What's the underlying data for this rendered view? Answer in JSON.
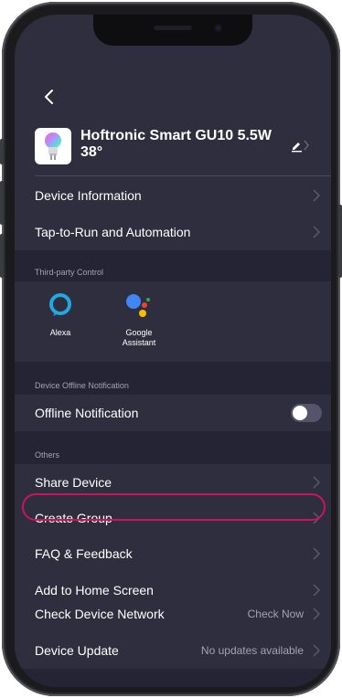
{
  "header": {
    "device_name": "Hoftronic Smart GU10 5.5W 38°",
    "thumb_icon": "bulb-icon",
    "edit_icon": "pencil-icon"
  },
  "rows": {
    "device_information": "Device Information",
    "tap_to_run": "Tap-to-Run and Automation",
    "offline_notification": "Offline Notification",
    "share_device": "Share Device",
    "create_group": "Create Group",
    "faq_feedback": "FAQ & Feedback",
    "add_home_screen": "Add to Home Screen",
    "check_network": "Check Device Network",
    "check_network_value": "Check Now",
    "device_update": "Device Update",
    "device_update_value": "No updates available"
  },
  "sections": {
    "third_party": "Third-party Control",
    "offline": "Device Offline Notification",
    "others": "Others"
  },
  "third_party": {
    "alexa": "Alexa",
    "google_line1": "Google",
    "google_line2": "Assistant"
  },
  "toggles": {
    "offline_notification_on": false
  },
  "colors": {
    "background": "#2f2e3f",
    "section_background": "#252434",
    "highlight": "#c8155b",
    "alexa": "#22a7e0",
    "google_blue": "#4285f4",
    "google_red": "#ea4335",
    "google_yellow": "#fbbc05",
    "google_green": "#34a853"
  }
}
